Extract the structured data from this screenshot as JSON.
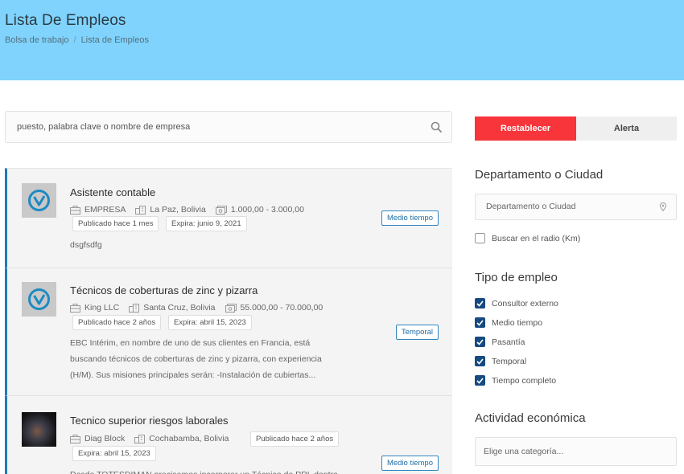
{
  "header": {
    "title": "Lista De Empleos",
    "breadcrumb": [
      "Bolsa de trabajo",
      "Lista de Empleos"
    ],
    "breadcrumb_sep": "/"
  },
  "search": {
    "placeholder": "puesto, palabra clave o nombre de empresa"
  },
  "jobs": [
    {
      "title": "Asistente contable",
      "company": "EMPRESA",
      "location": "La Paz, Bolivia",
      "salary": "1.000,00 - 3.000,00",
      "published": "Publicado hace 1 mes",
      "expires": "Expira: junio 9, 2021",
      "type": "Medio tiempo",
      "description": "dsgfsdfg"
    },
    {
      "title": "Técnicos de coberturas de zinc y pizarra",
      "company": "King LLC",
      "location": "Santa Cruz, Bolivia",
      "salary": "55.000,00 - 70.000,00",
      "published": "Publicado hace 2 años",
      "expires": "Expira: abril 15, 2023",
      "type": "Temporal",
      "description": "EBC Intérim, en nombre de uno de sus clientes en Francia, está buscando técnicos de coberturas de zinc y pizarra, con experiencia (H/M). Sus misiones principales serán: -Instalación de cubiertas..."
    },
    {
      "title": "Tecnico superior riesgos laborales",
      "company": "Diag Block",
      "location": "Cochabamba, Bolivia",
      "published": "Publicado hace 2 años",
      "expires": "Expira: abril 15, 2023",
      "type": "Medio tiempo",
      "description": "Desde TOTESDIMAN precisamos incorporar un Técnico de PRL dentro"
    }
  ],
  "sidebar": {
    "reset_label": "Restablecer",
    "alert_label": "Alerta",
    "location_heading": "Departamento o Ciudad",
    "location_placeholder": "Departamento o Ciudad",
    "radius_label": "Buscar en el radio (Km)",
    "job_type_heading": "Tipo de empleo",
    "job_types": [
      {
        "label": "Consultor externo",
        "checked": true
      },
      {
        "label": "Medio tiempo",
        "checked": true
      },
      {
        "label": "Pasantía",
        "checked": true
      },
      {
        "label": "Temporal",
        "checked": true
      },
      {
        "label": "Tiempo completo",
        "checked": true
      }
    ],
    "activity_heading": "Actividad económica",
    "activity_placeholder": "Elige una categoría..."
  },
  "colors": {
    "hero": "#7fd3fd",
    "accent_red": "#f7353a",
    "card_border": "#1e7bb8",
    "checkbox": "#164a80"
  }
}
